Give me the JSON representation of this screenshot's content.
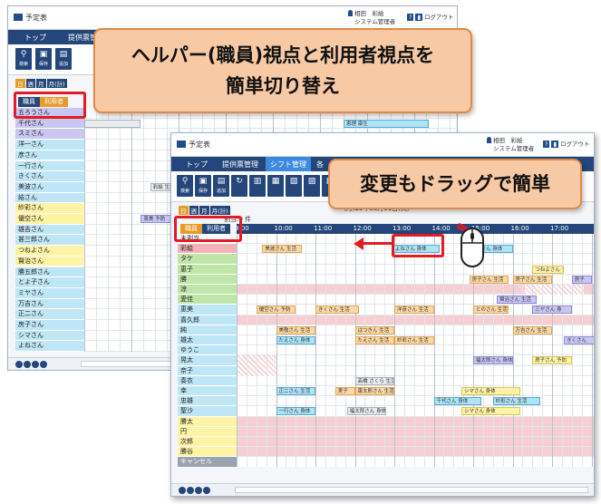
{
  "callouts": {
    "top_line1": "ヘルパー(職員)視点と利用者視点を",
    "top_line2": "簡単切り替え",
    "drag": "変更もドラッグで簡単"
  },
  "app": {
    "title": "予定表",
    "user_name": "相田　彩絵",
    "user_role": "システム管理者",
    "logout": "ログアウト",
    "nav_top": "トップ",
    "nav_provider": "提供票管理",
    "nav_shift": "シフト管理",
    "nav_more": "各",
    "tool_labels": [
      "検索",
      "保存",
      "追加",
      "",
      "",
      "",
      "",
      "",
      "",
      "登録"
    ]
  },
  "toggle": {
    "staff": "職員",
    "user": "利用者"
  },
  "day_tabs": [
    "日",
    "週",
    "月",
    "月(計)"
  ],
  "back": {
    "users": [
      {
        "name": "五ろうさん",
        "color": "#c9c7f2"
      },
      {
        "name": "千代さん",
        "color": "#c9c7f2"
      },
      {
        "name": "スミさん",
        "color": "#c9c7f2"
      },
      {
        "name": "洋一さん",
        "color": "#bfe6f7"
      },
      {
        "name": "彦さん",
        "color": "#bfe6f7"
      },
      {
        "name": "一行さん",
        "color": "#bfe6f7"
      },
      {
        "name": "きくさん",
        "color": "#bfe6f7"
      },
      {
        "name": "美波さん",
        "color": "#bfe6f7"
      },
      {
        "name": "結さん",
        "color": "#bfe6f7"
      },
      {
        "name": "紗彩さん",
        "color": "#fff3a6"
      },
      {
        "name": "優空さん",
        "color": "#fff3a6"
      },
      {
        "name": "雄吉さん",
        "color": "#bfe6f7"
      },
      {
        "name": "甚三郎さん",
        "color": "#bfe6f7"
      },
      {
        "name": "つねよさん",
        "color": "#fff3a6"
      },
      {
        "name": "賢治さん",
        "color": "#fff3a6"
      },
      {
        "name": "勝五郎さん",
        "color": "#bfe6f7"
      },
      {
        "name": "とよ子さん",
        "color": "#bfe6f7"
      },
      {
        "name": "ミヤさん",
        "color": "#bfe6f7"
      },
      {
        "name": "万吉さん",
        "color": "#bfe6f7"
      },
      {
        "name": "正二さん",
        "color": "#bfe6f7"
      },
      {
        "name": "房子さん",
        "color": "#bfe6f7"
      },
      {
        "name": "シマさん",
        "color": "#bfe6f7"
      },
      {
        "name": "よねさん",
        "color": "#bfe6f7"
      }
    ],
    "events": [
      {
        "row": 1,
        "col": 0.0,
        "w": 1.2,
        "text": "",
        "cls": "g"
      },
      {
        "row": 1,
        "col": 5.5,
        "w": 1.8,
        "text": "恵理 康生",
        "cls": "b"
      },
      {
        "row": 7,
        "col": 1.4,
        "w": 1.1,
        "text": "彩絵 生活",
        "cls": "g"
      },
      {
        "row": 10,
        "col": 1.2,
        "w": 1.0,
        "text": "恵美 予防",
        "cls": "l"
      },
      {
        "row": 19,
        "col": 2.2,
        "w": 1.2,
        "text": "幸 身生",
        "cls": "b"
      },
      {
        "row": 6,
        "col": 2.2,
        "w": 0.6,
        "text": "愛 身体",
        "cls": "b"
      },
      {
        "row": 9,
        "col": 3.2,
        "w": 0.6,
        "text": "恵理 康生",
        "cls": "b"
      }
    ]
  },
  "front": {
    "date_text": "(月)29年08月01日(火)",
    "count_text": "割当:0 件",
    "times": [
      "9:00",
      "10:00",
      "11:00",
      "12:00",
      "13:00",
      "14:00",
      "15:00",
      "16:00",
      "17:00"
    ],
    "staff": [
      {
        "name": "未割当",
        "color": "#ffffff"
      },
      {
        "name": "彩絵",
        "color": "#f2b2b7"
      },
      {
        "name": "タケ",
        "color": "#bfe6a8"
      },
      {
        "name": "恵子",
        "color": "#bfe6a8"
      },
      {
        "name": "勝",
        "color": "#bfe6a8"
      },
      {
        "name": "涼",
        "color": "#bfe6a8"
      },
      {
        "name": "愛佳",
        "color": "#bfe6a8"
      },
      {
        "name": "恵美",
        "color": "#bfe6f7"
      },
      {
        "name": "喜久郎",
        "color": "#bfe6f7"
      },
      {
        "name": "純",
        "color": "#bfe6f7"
      },
      {
        "name": "雄太",
        "color": "#bfe6f7"
      },
      {
        "name": "ゆうこ",
        "color": "#bfe6f7"
      },
      {
        "name": "晃太",
        "color": "#bfe6f7"
      },
      {
        "name": "奈子",
        "color": "#bfe6f7"
      },
      {
        "name": "奏衣",
        "color": "#bfe6f7"
      },
      {
        "name": "幸",
        "color": "#bfe6f7"
      },
      {
        "name": "忠雄",
        "color": "#bfe6f7"
      },
      {
        "name": "聖沙",
        "color": "#bfe6f7"
      },
      {
        "name": "勝太",
        "color": "#fff3a6"
      },
      {
        "name": "円",
        "color": "#fff3a6"
      },
      {
        "name": "次郎",
        "color": "#fff3a6"
      },
      {
        "name": "勝谷",
        "color": "#fff3a6"
      },
      {
        "name": "キャンセル",
        "color": "#9aa3ad"
      }
    ],
    "events": [
      {
        "row": 1,
        "col": 0.65,
        "w": 1.0,
        "text": "美波さん 生活",
        "cls": "o"
      },
      {
        "row": 1,
        "col": 3.95,
        "w": 1.2,
        "text": "よねさん 身体",
        "cls": "b"
      },
      {
        "row": 1,
        "col": 6.0,
        "w": 1.0,
        "text": "桜さん 身体",
        "cls": "b"
      },
      {
        "row": 3,
        "col": 7.5,
        "w": 0.8,
        "text": "つねよさん 予防",
        "cls": "y"
      },
      {
        "row": 4,
        "col": 5.9,
        "w": 1.0,
        "text": "房子さん 生活",
        "cls": "o"
      },
      {
        "row": 4,
        "col": 7.0,
        "w": 1.0,
        "text": "房子さん 生活",
        "cls": "o"
      },
      {
        "row": 4,
        "col": 8.5,
        "w": 0.5,
        "text": "房子",
        "cls": "l"
      },
      {
        "row": 6,
        "col": 6.6,
        "w": 1.0,
        "text": "賢治さん 生活",
        "cls": "l"
      },
      {
        "row": 7,
        "col": 0.5,
        "w": 1.0,
        "text": "優空さん 予防",
        "cls": "o"
      },
      {
        "row": 7,
        "col": 2.0,
        "w": 1.1,
        "text": "きくさん 生活",
        "cls": "o"
      },
      {
        "row": 7,
        "col": 4.0,
        "w": 1.0,
        "text": "洋彦さん 生活",
        "cls": "o"
      },
      {
        "row": 7,
        "col": 6.0,
        "w": 0.9,
        "text": "とのさん 生活",
        "cls": "o"
      },
      {
        "row": 7,
        "col": 7.5,
        "w": 1.0,
        "text": "三ヤさん 身",
        "cls": "l"
      },
      {
        "row": 9,
        "col": 1.0,
        "w": 1.0,
        "text": "美敬さん 生活",
        "cls": "o"
      },
      {
        "row": 9,
        "col": 3.0,
        "w": 1.0,
        "text": "はつきん 生活",
        "cls": "o"
      },
      {
        "row": 9,
        "col": 7.0,
        "w": 1.0,
        "text": "万吉さん 生活",
        "cls": "o"
      },
      {
        "row": 10,
        "col": 1.0,
        "w": 1.0,
        "text": "たえさん 身体",
        "cls": "b"
      },
      {
        "row": 10,
        "col": 3.0,
        "w": 1.0,
        "text": "たえさん 生活",
        "cls": "o"
      },
      {
        "row": 10,
        "col": 4.0,
        "w": 1.0,
        "text": "紗彩さん 生活",
        "cls": "o"
      },
      {
        "row": 10,
        "col": 8.3,
        "w": 0.8,
        "text": "きくさん",
        "cls": "l"
      },
      {
        "row": 12,
        "col": 6.0,
        "w": 1.0,
        "text": "福太郎さん 身体",
        "cls": "l"
      },
      {
        "row": 12,
        "col": 7.5,
        "w": 1.0,
        "text": "房子さん 予防",
        "cls": "y"
      },
      {
        "row": 14,
        "col": 3.0,
        "w": 1.0,
        "text": "高橋 さくら 生活",
        "cls": "g"
      },
      {
        "row": 15,
        "col": 1.0,
        "w": 1.0,
        "text": "正二さん 生活",
        "cls": "b"
      },
      {
        "row": 15,
        "col": 2.5,
        "w": 0.5,
        "text": "実子",
        "cls": "o"
      },
      {
        "row": 15,
        "col": 3.0,
        "w": 1.0,
        "text": "康太郎さん 生活",
        "cls": "o"
      },
      {
        "row": 15,
        "col": 5.7,
        "w": 1.5,
        "text": "シマさん 身体",
        "cls": "y"
      },
      {
        "row": 16,
        "col": 5.0,
        "w": 1.2,
        "text": "千代さん 身体",
        "cls": "b"
      },
      {
        "row": 16,
        "col": 6.5,
        "w": 1.2,
        "text": "紗彩さん 生活",
        "cls": "b"
      },
      {
        "row": 17,
        "col": 1.0,
        "w": 1.0,
        "text": "一行さん 身体",
        "cls": "b"
      },
      {
        "row": 17,
        "col": 2.8,
        "w": 1.0,
        "text": "福太郎さん 身体",
        "cls": "g"
      },
      {
        "row": 17,
        "col": 5.7,
        "w": 1.5,
        "text": "シマさん 身体",
        "cls": "y"
      }
    ]
  }
}
